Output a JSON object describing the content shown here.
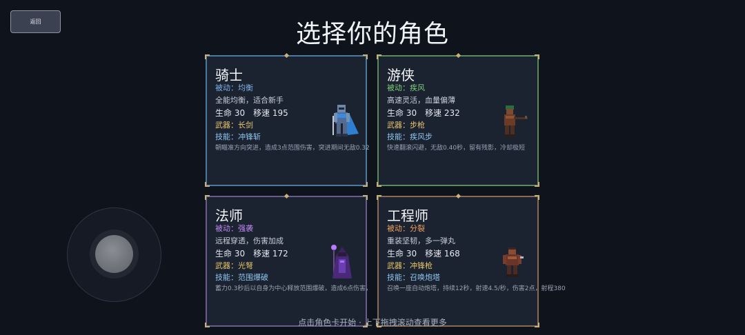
{
  "back_button": {
    "label": "返回"
  },
  "title": "选择你的角色",
  "cards": [
    {
      "name": "骑士",
      "passive": "被动：均衡",
      "desc": "全能均衡，适合新手",
      "stats": "生命 30　移速 195",
      "weapon": "武器：长剑",
      "skill": "技能：冲锋斩",
      "skill_desc": "朝瞄准方向突进，造成3点范围伤害，突进期间无敌0.32"
    },
    {
      "name": "游侠",
      "passive": "被动：疾风",
      "desc": "高速灵活，血量偏薄",
      "stats": "生命 30　移速 232",
      "weapon": "武器：步枪",
      "skill": "技能：疾风步",
      "skill_desc": "快速翻滚闪避，无敌0.40秒，留有残影，冷却极短"
    },
    {
      "name": "法师",
      "passive": "被动：强袭",
      "desc": "远程穿透，伤害加成",
      "stats": "生命 30　移速 172",
      "weapon": "武器：光弩",
      "skill": "技能：范围爆破",
      "skill_desc": "蓄力0.3秒后以自身为中心释放范围爆破，造成6点伤害，"
    },
    {
      "name": "工程师",
      "passive": "被动：分裂",
      "desc": "重装坚韧，多一弹丸",
      "stats": "生命 30　移速 168",
      "weapon": "武器：冲锋枪",
      "skill": "技能：召唤炮塔",
      "skill_desc": "召唤一座自动炮塔，持续12秒，射速4.5/秒，伤害2点，射程380"
    }
  ],
  "hint": "点击角色卡开始 · 上下拖拽滚动查看更多"
}
